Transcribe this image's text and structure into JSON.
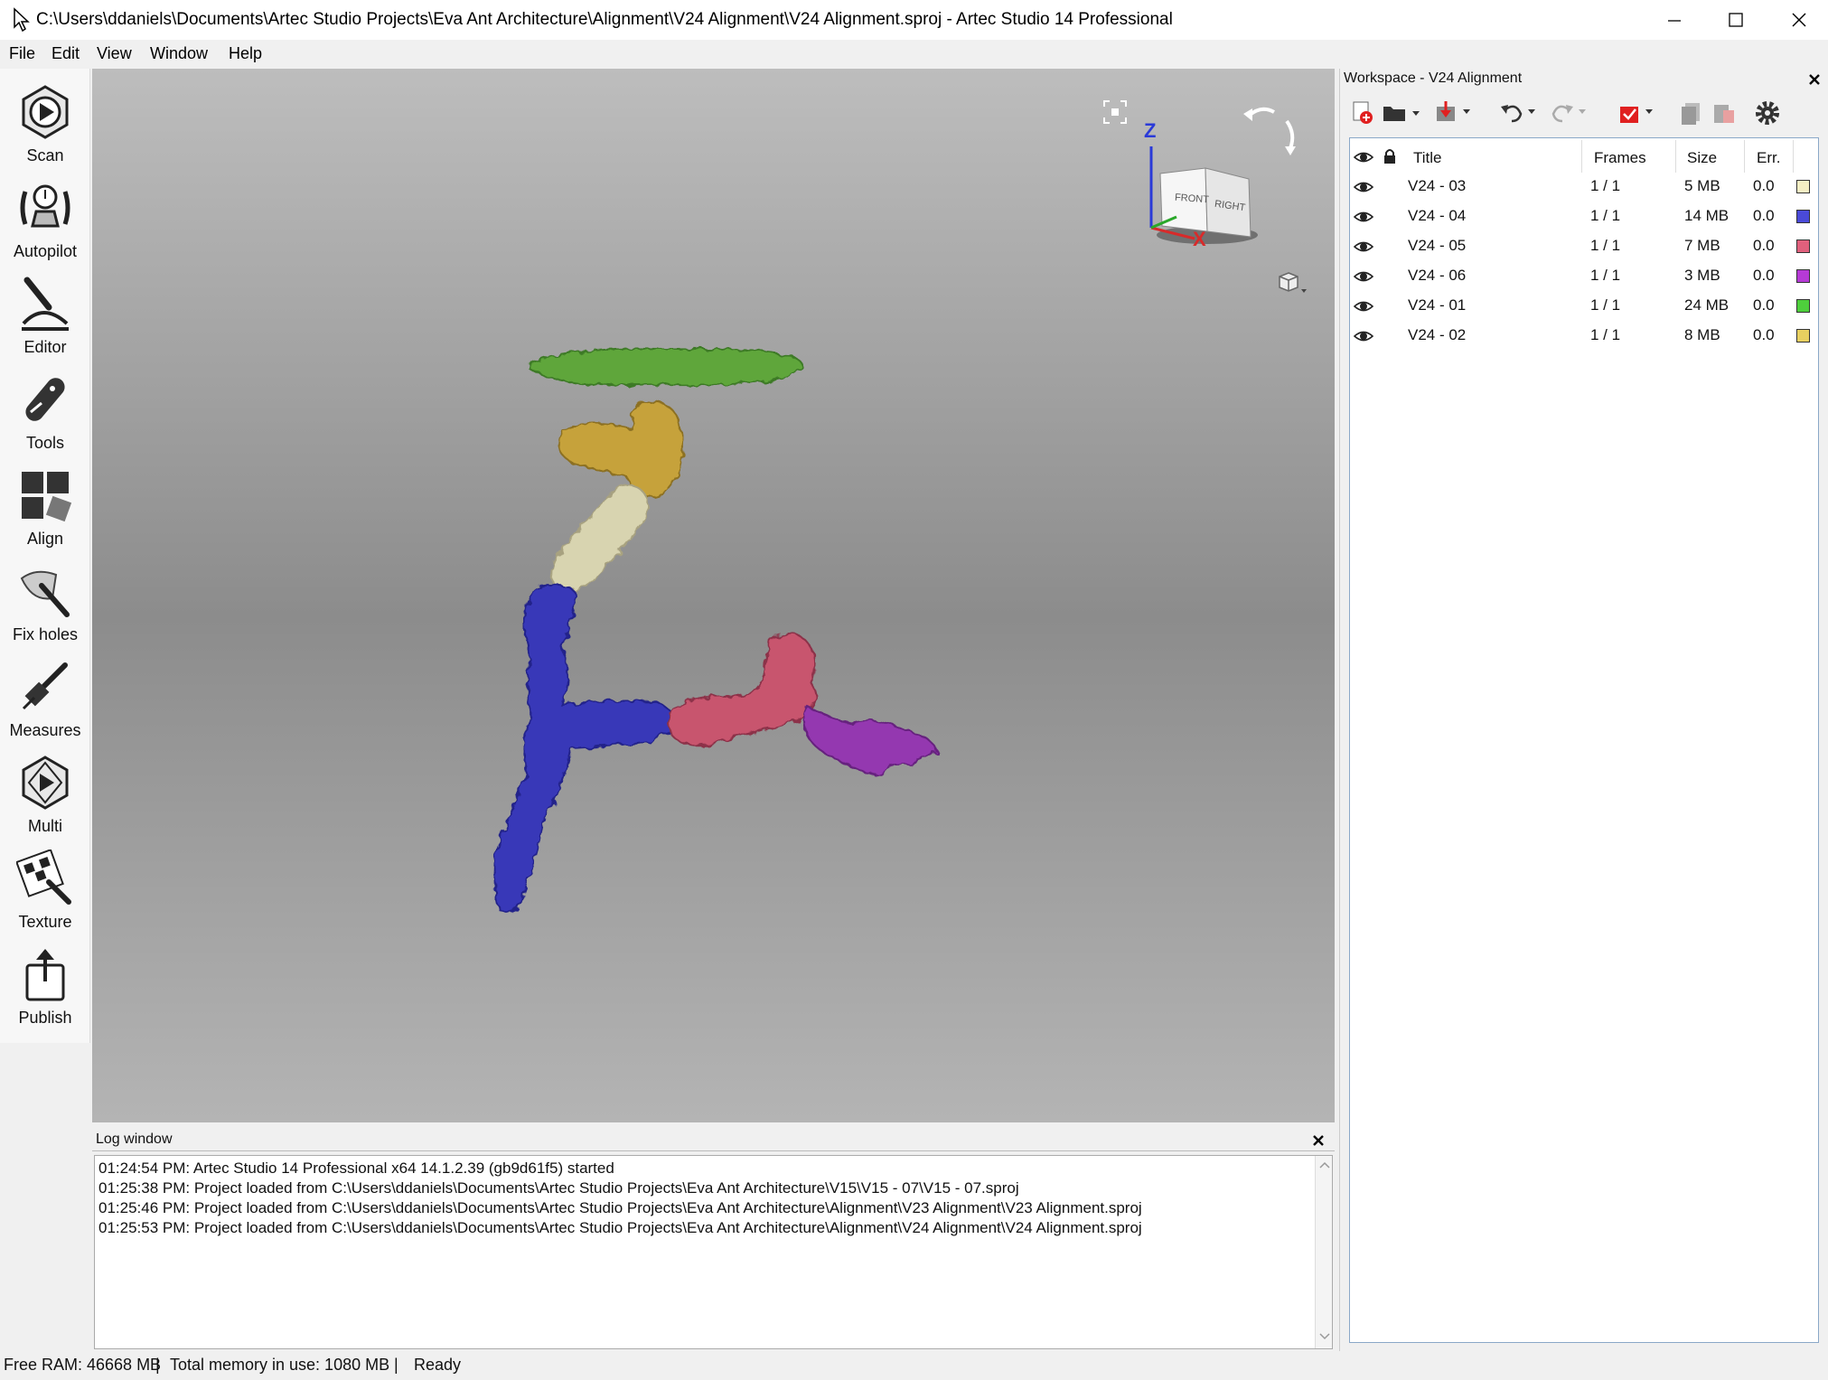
{
  "window": {
    "title": "C:\\Users\\ddaniels\\Documents\\Artec Studio Projects\\Eva Ant Architecture\\Alignment\\V24 Alignment\\V24 Alignment.sproj - Artec Studio 14 Professional"
  },
  "menu": {
    "file": "File",
    "edit": "Edit",
    "view": "View",
    "window": "Window",
    "help": "Help"
  },
  "tools": [
    {
      "label": "Scan",
      "icon": "scan-icon"
    },
    {
      "label": "Autopilot",
      "icon": "autopilot-icon"
    },
    {
      "label": "Editor",
      "icon": "editor-icon"
    },
    {
      "label": "Tools",
      "icon": "tools-icon"
    },
    {
      "label": "Align",
      "icon": "align-icon"
    },
    {
      "label": "Fix holes",
      "icon": "fix-holes-icon"
    },
    {
      "label": "Measures",
      "icon": "measures-icon"
    },
    {
      "label": "Multi",
      "icon": "multi-icon"
    },
    {
      "label": "Texture",
      "icon": "texture-icon"
    },
    {
      "label": "Publish",
      "icon": "publish-icon"
    }
  ],
  "viewcube": {
    "front": "FRONT",
    "right": "RIGHT",
    "z_axis": "Z",
    "x_axis": "X"
  },
  "log": {
    "title": "Log window",
    "lines": [
      "01:24:54 PM: Artec Studio 14 Professional x64 14.1.2.39 (gb9d61f5) started",
      "01:25:38 PM: Project loaded from C:\\Users\\ddaniels\\Documents\\Artec Studio Projects\\Eva Ant Architecture\\V15\\V15 - 07\\V15 - 07.sproj",
      "01:25:46 PM: Project loaded from C:\\Users\\ddaniels\\Documents\\Artec Studio Projects\\Eva Ant Architecture\\Alignment\\V23 Alignment\\V23 Alignment.sproj",
      "01:25:53 PM: Project loaded from C:\\Users\\ddaniels\\Documents\\Artec Studio Projects\\Eva Ant Architecture\\Alignment\\V24 Alignment\\V24 Alignment.sproj"
    ]
  },
  "workspace": {
    "title": "Workspace - V24 Alignment",
    "columns": {
      "title": "Title",
      "frames": "Frames",
      "size": "Size",
      "err": "Err."
    },
    "rows": [
      {
        "title": "V24 - 03",
        "frames": "1 / 1",
        "size": "5 MB",
        "err": "0.0",
        "color": "#f6efc4"
      },
      {
        "title": "V24 - 04",
        "frames": "1 / 1",
        "size": "14 MB",
        "err": "0.0",
        "color": "#4a4ad8"
      },
      {
        "title": "V24 - 05",
        "frames": "1 / 1",
        "size": "7 MB",
        "err": "0.0",
        "color": "#e0607c"
      },
      {
        "title": "V24 - 06",
        "frames": "1 / 1",
        "size": "3 MB",
        "err": "0.0",
        "color": "#b63ad6"
      },
      {
        "title": "V24 - 01",
        "frames": "1 / 1",
        "size": "24 MB",
        "err": "0.0",
        "color": "#4ecf3c"
      },
      {
        "title": "V24 - 02",
        "frames": "1 / 1",
        "size": "8 MB",
        "err": "0.0",
        "color": "#e8d060"
      }
    ]
  },
  "status": {
    "free_ram": "Free RAM: 46668 MB",
    "total_memory": "Total memory in use: 1080 MB",
    "state": "Ready"
  },
  "colors": {
    "mesh_green": "#5ea63a",
    "mesh_gold": "#c6a23a",
    "mesh_cream": "#d8d4b0",
    "mesh_blue": "#3838b8",
    "mesh_pink": "#c8546e",
    "mesh_purple": "#9438b0"
  }
}
